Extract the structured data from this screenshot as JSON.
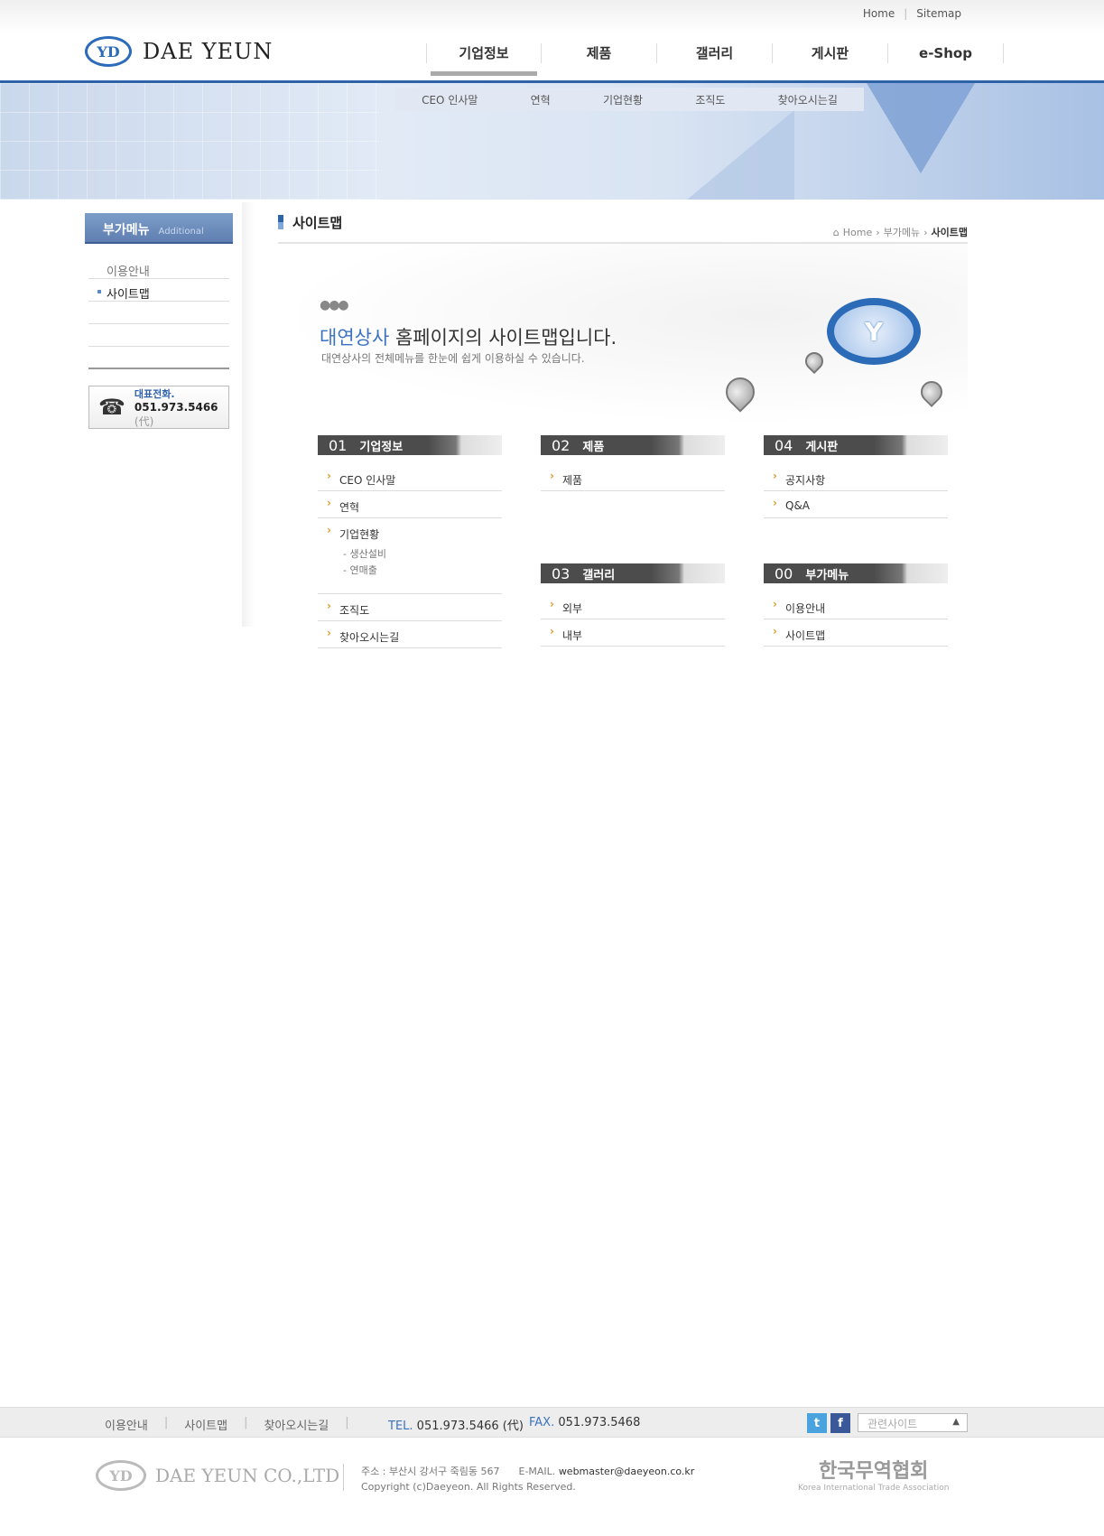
{
  "top_links": [
    "Home",
    "Sitemap"
  ],
  "logo_text": "DAE YEUN",
  "gnb": [
    "기업정보",
    "제품",
    "갤러리",
    "게시판",
    "e-Shop"
  ],
  "subnav": [
    "CEO 인사말",
    "연혁",
    "기업현황",
    "조직도",
    "찾아오시는길"
  ],
  "lnb": {
    "title": "부가메뉴",
    "subtitle": "Additional",
    "items": [
      "이용안내",
      "사이트맵"
    ],
    "phone_label": "대표전화.",
    "phone_number": "051.973.5466",
    "phone_suffix": "(代)"
  },
  "content": {
    "title": "사이트맵",
    "breadcrumb": [
      "Home",
      "부가메뉴",
      "사이트맵"
    ],
    "hero_highlight": "대연상사",
    "hero_rest": " 홈페이지의 사이트맵입니다.",
    "hero_sub": "대연상사의 전체메뉴를 한눈에 쉽게 이용하실 수 있습니다."
  },
  "sections": [
    {
      "num": "01",
      "title": "기업정보",
      "items": [
        "CEO 인사말",
        "연혁",
        "기업현황",
        "조직도",
        "찾아오시는길"
      ],
      "subitems": [
        "- 생산설비",
        "- 연매출"
      ]
    },
    {
      "num": "02",
      "title": "제품",
      "items": [
        "제품"
      ]
    },
    {
      "num": "03",
      "title": "갤러리",
      "items": [
        "외부",
        "내부"
      ]
    },
    {
      "num": "04",
      "title": "게시판",
      "items": [
        "공지사항",
        "Q&A"
      ]
    },
    {
      "num": "00",
      "title": "부가메뉴",
      "items": [
        "이용안내",
        "사이트맵"
      ]
    }
  ],
  "footer": {
    "links": [
      "이용안내",
      "사이트맵",
      "찾아오시는길"
    ],
    "tel_label": "TEL.",
    "tel": "051.973.5466 (代)",
    "fax_label": "FAX.",
    "fax": "051.973.5468",
    "related": "관련사이트",
    "logo_text": "DAE YEUN CO.,LTD",
    "address": "주소 : 부산시 강서구 죽림동 567",
    "email_label": "E-MAIL.",
    "email": "webmaster@daeyeon.co.kr",
    "copyright": "Copyright (c)Daeyeon. All Rights Reserved.",
    "assoc_name": "한국무역협회",
    "assoc_en": "Korea International Trade Association"
  },
  "colors": {
    "accent": "#2f63a8",
    "orange": "#e09a2a",
    "section_head": "#4c4c4c"
  }
}
